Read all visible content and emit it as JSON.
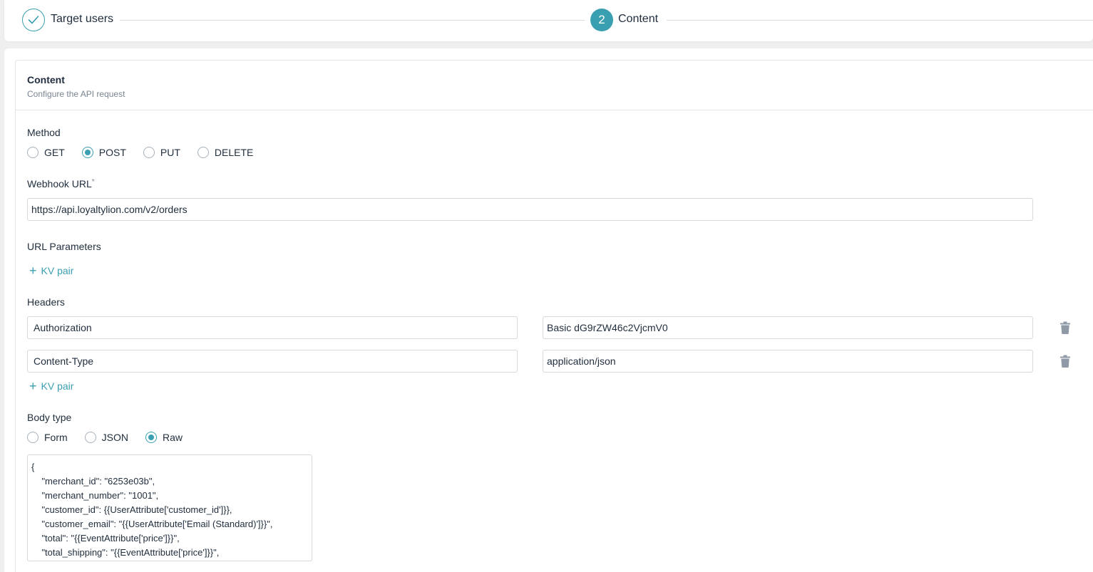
{
  "stepper": {
    "steps": [
      {
        "number": "",
        "label": "Target users",
        "state": "completed"
      },
      {
        "number": "2",
        "label": "Content",
        "state": "active"
      }
    ]
  },
  "card": {
    "title": "Content",
    "subtitle": "Configure the API request"
  },
  "method": {
    "label": "Method",
    "options": [
      {
        "label": "GET",
        "checked": false
      },
      {
        "label": "POST",
        "checked": true
      },
      {
        "label": "PUT",
        "checked": false
      },
      {
        "label": "DELETE",
        "checked": false
      }
    ]
  },
  "webhook": {
    "label": "Webhook URL",
    "required_mark": "*",
    "value": "https://api.loyaltylion.com/v2/orders"
  },
  "url_params": {
    "label": "URL Parameters",
    "add_label": "KV pair"
  },
  "headers": {
    "label": "Headers",
    "rows": [
      {
        "key": "Authorization",
        "value": "Basic dG9rZW46c2VjcmV0"
      },
      {
        "key": "Content-Type",
        "value": "application/json"
      }
    ],
    "add_label": "KV pair"
  },
  "body_type": {
    "label": "Body type",
    "options": [
      {
        "label": "Form",
        "checked": false
      },
      {
        "label": "JSON",
        "checked": false
      },
      {
        "label": "Raw",
        "checked": true
      }
    ]
  },
  "body": {
    "value": "{\n    \"merchant_id\": \"6253e03b\",\n    \"merchant_number\": \"1001\",\n    \"customer_id\": {{UserAttribute['customer_id']}},\n    \"customer_email\": \"{{UserAttribute['Email (Standard)']}}\",\n    \"total\": \"{{EventAttribute['price']}}\",\n    \"total_shipping\": \"{{EventAttribute['price']}}\","
  },
  "colors": {
    "accent": "#3a9fb0",
    "trash": "#8f9aa6"
  },
  "icons": {
    "step_completed": "check-icon",
    "add": "plus-icon",
    "delete": "trash-icon"
  }
}
